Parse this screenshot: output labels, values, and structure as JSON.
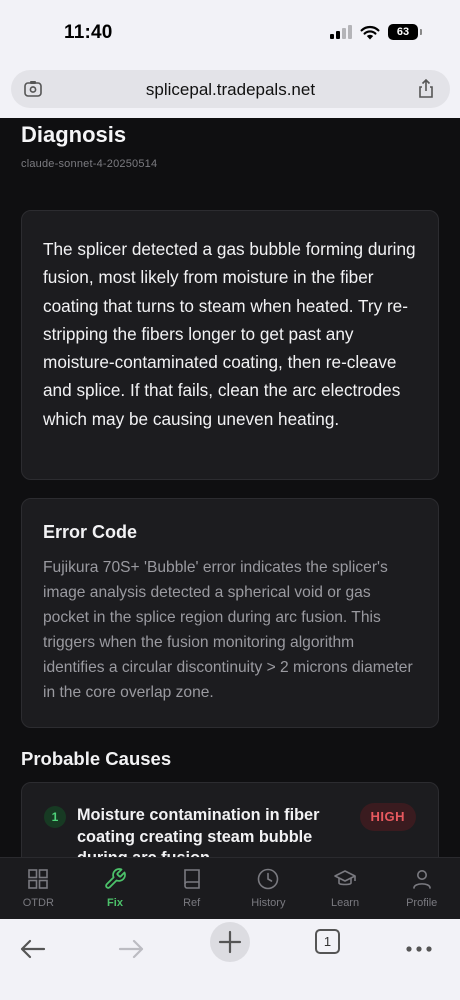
{
  "status": {
    "time": "11:40",
    "battery": "63"
  },
  "browser": {
    "url": "splicepal.tradepals.net",
    "tab_count": "1"
  },
  "page": {
    "title": "Diagnosis",
    "model": "claude-sonnet-4-20250514",
    "summary": "The splicer detected a gas bubble forming during fusion, most likely from moisture in the fiber coating that turns to steam when heated. Try re-stripping the fibers longer to get past any moisture-contaminated coating, then re-cleave and splice. If that fails, clean the arc electrodes which may be causing uneven heating.",
    "error_code": {
      "title": "Error Code",
      "text": "Fujikura 70S+ 'Bubble' error indicates the splicer's image analysis detected a spherical void or gas pocket in the splice region during arc fusion. This triggers when the fusion monitoring algorithm identifies a circular discontinuity > 2 microns diameter in the core overlap zone."
    },
    "causes_title": "Probable Causes",
    "causes": [
      {
        "num": "1",
        "text": "Moisture contamination in fiber coating creating steam bubble during arc fusion",
        "severity": "HIGH"
      }
    ]
  },
  "tabs": [
    {
      "label": "OTDR",
      "icon": "grid-icon"
    },
    {
      "label": "Fix",
      "icon": "wrench-icon",
      "active": true
    },
    {
      "label": "Ref",
      "icon": "book-icon"
    },
    {
      "label": "History",
      "icon": "clock-icon"
    },
    {
      "label": "Learn",
      "icon": "graduation-cap-icon"
    },
    {
      "label": "Profile",
      "icon": "person-icon"
    }
  ],
  "colors": {
    "accent": "#4cc26a",
    "high_badge": "#e8595f",
    "card_bg": "#1c1c1f"
  }
}
